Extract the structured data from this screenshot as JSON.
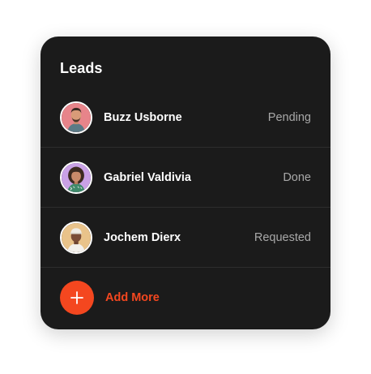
{
  "title": "Leads",
  "leads": [
    {
      "name": "Buzz Usborne",
      "status": "Pending",
      "avatar_icon": "avatar-man-beard",
      "avatar_bg": "#e7848a"
    },
    {
      "name": "Gabriel Valdivia",
      "status": "Done",
      "avatar_icon": "avatar-woman-curly",
      "avatar_bg": "#c9a1e6"
    },
    {
      "name": "Jochem Dierx",
      "status": "Requested",
      "avatar_icon": "avatar-man-cap",
      "avatar_bg": "#e9c38a"
    }
  ],
  "add_more": {
    "label": "Add More",
    "icon": "plus-icon"
  },
  "colors": {
    "card_bg": "#1b1b1b",
    "accent": "#f4471f",
    "status_text": "#a8a8a8",
    "divider": "#2d2d2d"
  }
}
